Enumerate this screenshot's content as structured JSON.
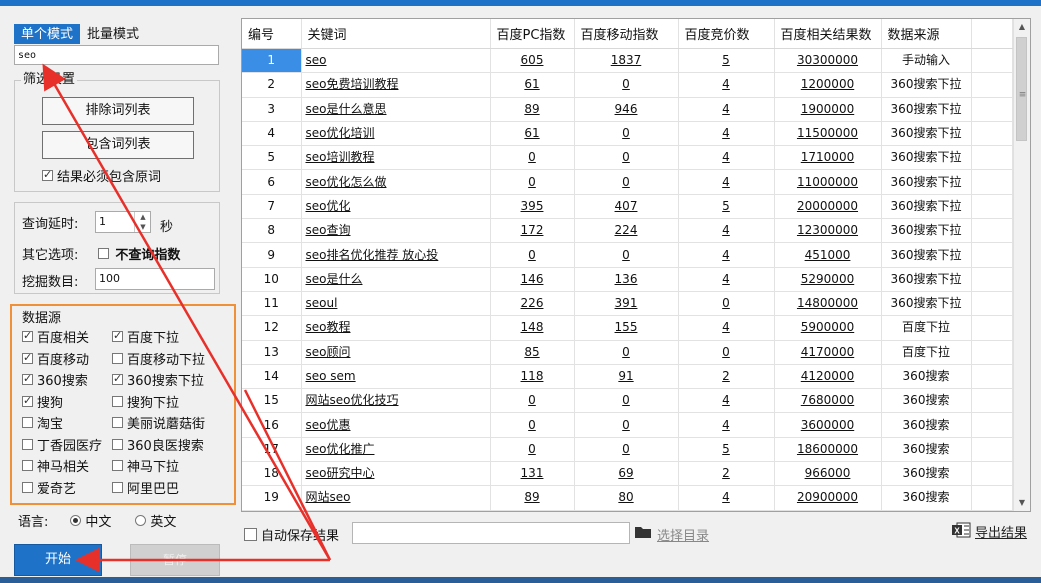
{
  "tabs": [
    "单个模式",
    "批量模式"
  ],
  "keyword_input": "seo",
  "filter": {
    "title": "筛选设置",
    "exclude_button": "排除词列表",
    "include_button": "包含词列表",
    "must_contain_label": "结果必须包含原词",
    "must_contain_checked": true
  },
  "query": {
    "delay_label": "查询延时:",
    "delay_value": "1",
    "delay_unit": "秒",
    "other_label": "其它选项:",
    "no_index_label": "不查询指数",
    "no_index_checked": false,
    "count_label": "挖掘数目:",
    "count_value": "100"
  },
  "datasource": {
    "title": "数据源",
    "items": [
      {
        "label": "百度相关",
        "checked": true
      },
      {
        "label": "百度下拉",
        "checked": true
      },
      {
        "label": "百度移动",
        "checked": true
      },
      {
        "label": "百度移动下拉",
        "checked": false
      },
      {
        "label": "360搜索",
        "checked": true
      },
      {
        "label": "360搜索下拉",
        "checked": true
      },
      {
        "label": "搜狗",
        "checked": true
      },
      {
        "label": "搜狗下拉",
        "checked": false
      },
      {
        "label": "淘宝",
        "checked": false
      },
      {
        "label": "美丽说蘑菇街",
        "checked": false
      },
      {
        "label": "丁香园医疗",
        "checked": false
      },
      {
        "label": "360良医搜索",
        "checked": false
      },
      {
        "label": "神马相关",
        "checked": false
      },
      {
        "label": "神马下拉",
        "checked": false
      },
      {
        "label": "爱奇艺",
        "checked": false
      },
      {
        "label": "阿里巴巴",
        "checked": false
      }
    ]
  },
  "language": {
    "label": "语言:",
    "options": [
      {
        "label": "中文",
        "selected": true
      },
      {
        "label": "英文",
        "selected": false
      }
    ]
  },
  "buttons": {
    "start": "开始",
    "pause": "暂停"
  },
  "table": {
    "columns": [
      "编号",
      "关键词",
      "百度PC指数",
      "百度移动指数",
      "百度竞价数",
      "百度相关结果数",
      "数据来源"
    ],
    "selected_row": 1,
    "rows": [
      [
        "1",
        "seo",
        "605",
        "1837",
        "5",
        "30300000",
        "手动输入"
      ],
      [
        "2",
        "seo免费培训教程",
        "61",
        "0",
        "4",
        "1200000",
        "360搜索下拉"
      ],
      [
        "3",
        "seo是什么意思",
        "89",
        "946",
        "4",
        "1900000",
        "360搜索下拉"
      ],
      [
        "4",
        "seo优化培训",
        "61",
        "0",
        "4",
        "11500000",
        "360搜索下拉"
      ],
      [
        "5",
        "seo培训教程",
        "0",
        "0",
        "4",
        "1710000",
        "360搜索下拉"
      ],
      [
        "6",
        "seo优化怎么做",
        "0",
        "0",
        "4",
        "11000000",
        "360搜索下拉"
      ],
      [
        "7",
        "seo优化",
        "395",
        "407",
        "5",
        "20000000",
        "360搜索下拉"
      ],
      [
        "8",
        "seo查询",
        "172",
        "224",
        "4",
        "12300000",
        "360搜索下拉"
      ],
      [
        "9",
        "seo排名优化推荐 放心投",
        "0",
        "0",
        "4",
        "451000",
        "360搜索下拉"
      ],
      [
        "10",
        "seo是什么",
        "146",
        "136",
        "4",
        "5290000",
        "360搜索下拉"
      ],
      [
        "11",
        "seoul",
        "226",
        "391",
        "0",
        "14800000",
        "360搜索下拉"
      ],
      [
        "12",
        "seo教程",
        "148",
        "155",
        "4",
        "5900000",
        "百度下拉"
      ],
      [
        "13",
        "seo顾问",
        "85",
        "0",
        "0",
        "4170000",
        "百度下拉"
      ],
      [
        "14",
        "seo sem",
        "118",
        "91",
        "2",
        "4120000",
        "360搜索"
      ],
      [
        "15",
        "网站seo优化技巧",
        "0",
        "0",
        "4",
        "7680000",
        "360搜索"
      ],
      [
        "16",
        "seo优惠",
        "0",
        "0",
        "4",
        "3600000",
        "360搜索"
      ],
      [
        "17",
        "seo优化推广",
        "0",
        "0",
        "5",
        "18600000",
        "360搜索"
      ],
      [
        "18",
        "seo研究中心",
        "131",
        "69",
        "2",
        "966000",
        "360搜索"
      ],
      [
        "19",
        "网站seo",
        "89",
        "80",
        "4",
        "20900000",
        "360搜索"
      ]
    ]
  },
  "bottom": {
    "auto_save_label": "自动保存结果",
    "auto_save_checked": false,
    "choose_dir": "选择目录",
    "export": "导出结果"
  },
  "colors": {
    "accent": "#1e73c8",
    "annotation": "#e8302a",
    "highlight_box": "#f0913a"
  },
  "icons": [
    "folder-icon",
    "excel-icon",
    "scroll-up-icon",
    "scroll-down-icon"
  ]
}
